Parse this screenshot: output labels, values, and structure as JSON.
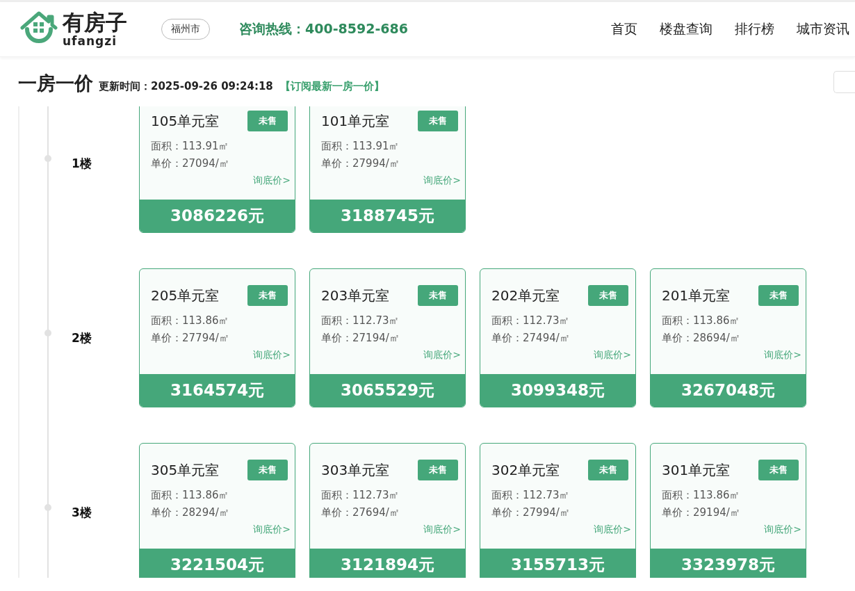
{
  "header": {
    "logo": {
      "title": "有房子",
      "subtitle": "ufangzi"
    },
    "city": "福州市",
    "hotline": "咨询热线：400-8592-686",
    "nav": [
      "首页",
      "楼盘查询",
      "排行榜",
      "城市资讯"
    ]
  },
  "title_bar": {
    "title": "一房一价",
    "updated_label": "更新时间：",
    "updated": "2025-09-26 09:24:18",
    "subscribe": "【订阅最新一房一价】"
  },
  "floors": [
    {
      "label": "1楼",
      "units": [
        {
          "name": "105单元室",
          "status": "未售",
          "area": "面积：113.91㎡",
          "unit_price": "单价：27094/㎡",
          "inquire": "询底价>",
          "price": "3086226元"
        },
        {
          "name": "101单元室",
          "status": "未售",
          "area": "面积：113.91㎡",
          "unit_price": "单价：27994/㎡",
          "inquire": "询底价>",
          "price": "3188745元"
        }
      ]
    },
    {
      "label": "2楼",
      "units": [
        {
          "name": "205单元室",
          "status": "未售",
          "area": "面积：113.86㎡",
          "unit_price": "单价：27794/㎡",
          "inquire": "询底价>",
          "price": "3164574元"
        },
        {
          "name": "203单元室",
          "status": "未售",
          "area": "面积：112.73㎡",
          "unit_price": "单价：27194/㎡",
          "inquire": "询底价>",
          "price": "3065529元"
        },
        {
          "name": "202单元室",
          "status": "未售",
          "area": "面积：112.73㎡",
          "unit_price": "单价：27494/㎡",
          "inquire": "询底价>",
          "price": "3099348元"
        },
        {
          "name": "201单元室",
          "status": "未售",
          "area": "面积：113.86㎡",
          "unit_price": "单价：28694/㎡",
          "inquire": "询底价>",
          "price": "3267048元"
        }
      ]
    },
    {
      "label": "3楼",
      "units": [
        {
          "name": "305单元室",
          "status": "未售",
          "area": "面积：113.86㎡",
          "unit_price": "单价：28294/㎡",
          "inquire": "询底价>",
          "price": "3221504元"
        },
        {
          "name": "303单元室",
          "status": "未售",
          "area": "面积：112.73㎡",
          "unit_price": "单价：27694/㎡",
          "inquire": "询底价>",
          "price": "3121894元"
        },
        {
          "name": "302单元室",
          "status": "未售",
          "area": "面积：112.73㎡",
          "unit_price": "单价：27994/㎡",
          "inquire": "询底价>",
          "price": "3155713元"
        },
        {
          "name": "301单元室",
          "status": "未售",
          "area": "面积：113.86㎡",
          "unit_price": "单价：29194/㎡",
          "inquire": "询底价>",
          "price": "3323978元"
        }
      ]
    }
  ]
}
